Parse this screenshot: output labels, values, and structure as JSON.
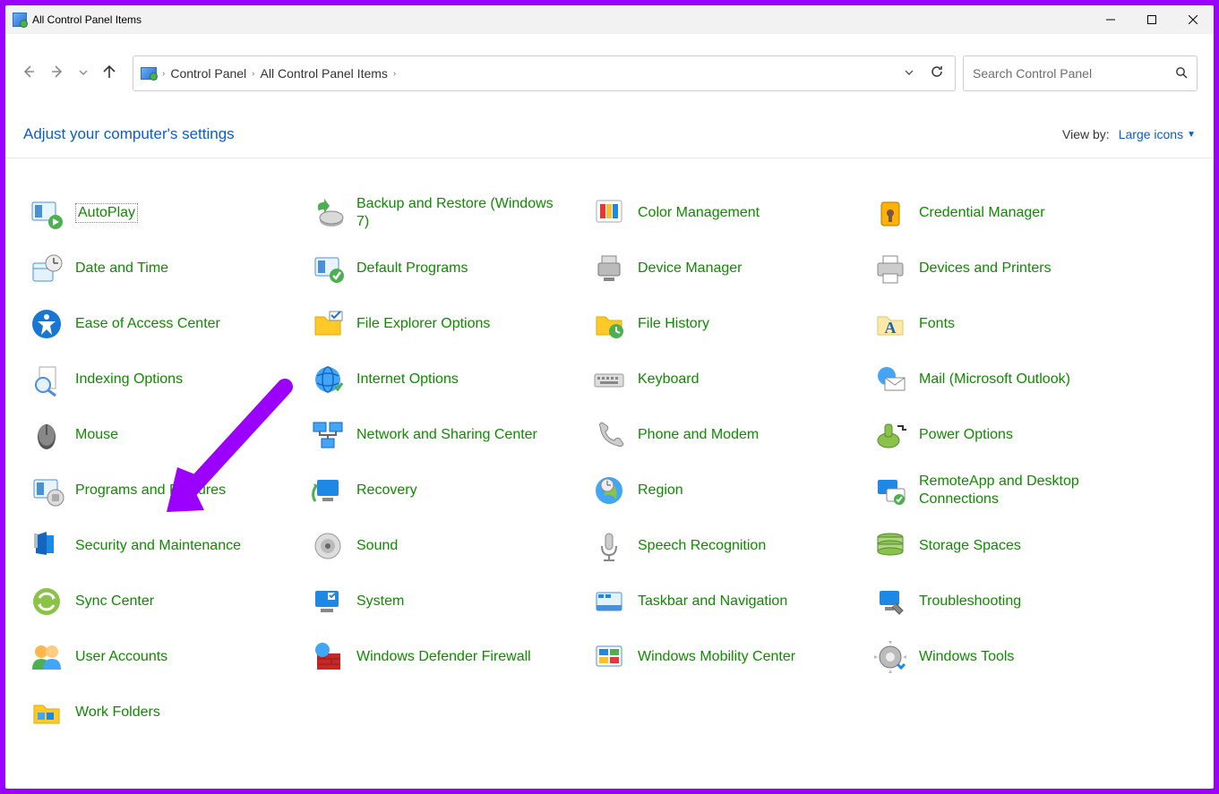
{
  "window": {
    "title": "All Control Panel Items"
  },
  "breadcrumb": {
    "root_icon": "cpl-root-icon",
    "segments": [
      "Control Panel",
      "All Control Panel Items"
    ]
  },
  "search": {
    "placeholder": "Search Control Panel"
  },
  "header": {
    "title": "Adjust your computer's settings",
    "viewby_label": "View by:",
    "viewby_value": "Large icons"
  },
  "items": [
    {
      "label": "AutoPlay",
      "icon": "autoplay-icon",
      "selected": true
    },
    {
      "label": "Backup and Restore (Windows 7)",
      "icon": "backup-icon"
    },
    {
      "label": "Color Management",
      "icon": "color-mgmt-icon"
    },
    {
      "label": "Credential Manager",
      "icon": "credential-icon"
    },
    {
      "label": "Date and Time",
      "icon": "datetime-icon"
    },
    {
      "label": "Default Programs",
      "icon": "default-programs-icon"
    },
    {
      "label": "Device Manager",
      "icon": "device-manager-icon"
    },
    {
      "label": "Devices and Printers",
      "icon": "printers-icon"
    },
    {
      "label": "Ease of Access Center",
      "icon": "ease-access-icon"
    },
    {
      "label": "File Explorer Options",
      "icon": "folder-options-icon"
    },
    {
      "label": "File History",
      "icon": "file-history-icon"
    },
    {
      "label": "Fonts",
      "icon": "fonts-icon"
    },
    {
      "label": "Indexing Options",
      "icon": "indexing-icon"
    },
    {
      "label": "Internet Options",
      "icon": "internet-icon"
    },
    {
      "label": "Keyboard",
      "icon": "keyboard-icon"
    },
    {
      "label": "Mail (Microsoft Outlook)",
      "icon": "mail-icon"
    },
    {
      "label": "Mouse",
      "icon": "mouse-icon"
    },
    {
      "label": "Network and Sharing Center",
      "icon": "network-icon"
    },
    {
      "label": "Phone and Modem",
      "icon": "phone-icon"
    },
    {
      "label": "Power Options",
      "icon": "power-icon"
    },
    {
      "label": "Programs and Features",
      "icon": "programs-icon"
    },
    {
      "label": "Recovery",
      "icon": "recovery-icon"
    },
    {
      "label": "Region",
      "icon": "region-icon"
    },
    {
      "label": "RemoteApp and Desktop Connections",
      "icon": "remoteapp-icon"
    },
    {
      "label": "Security and Maintenance",
      "icon": "security-icon"
    },
    {
      "label": "Sound",
      "icon": "sound-icon"
    },
    {
      "label": "Speech Recognition",
      "icon": "speech-icon"
    },
    {
      "label": "Storage Spaces",
      "icon": "storage-icon"
    },
    {
      "label": "Sync Center",
      "icon": "sync-icon"
    },
    {
      "label": "System",
      "icon": "system-icon"
    },
    {
      "label": "Taskbar and Navigation",
      "icon": "taskbar-icon"
    },
    {
      "label": "Troubleshooting",
      "icon": "troubleshoot-icon"
    },
    {
      "label": "User Accounts",
      "icon": "users-icon"
    },
    {
      "label": "Windows Defender Firewall",
      "icon": "firewall-icon"
    },
    {
      "label": "Windows Mobility Center",
      "icon": "mobility-icon"
    },
    {
      "label": "Windows Tools",
      "icon": "tools-icon"
    },
    {
      "label": "Work Folders",
      "icon": "workfolders-icon"
    }
  ],
  "annotation": {
    "arrow_color": "#9b00ff",
    "target_item": "Programs and Features"
  }
}
